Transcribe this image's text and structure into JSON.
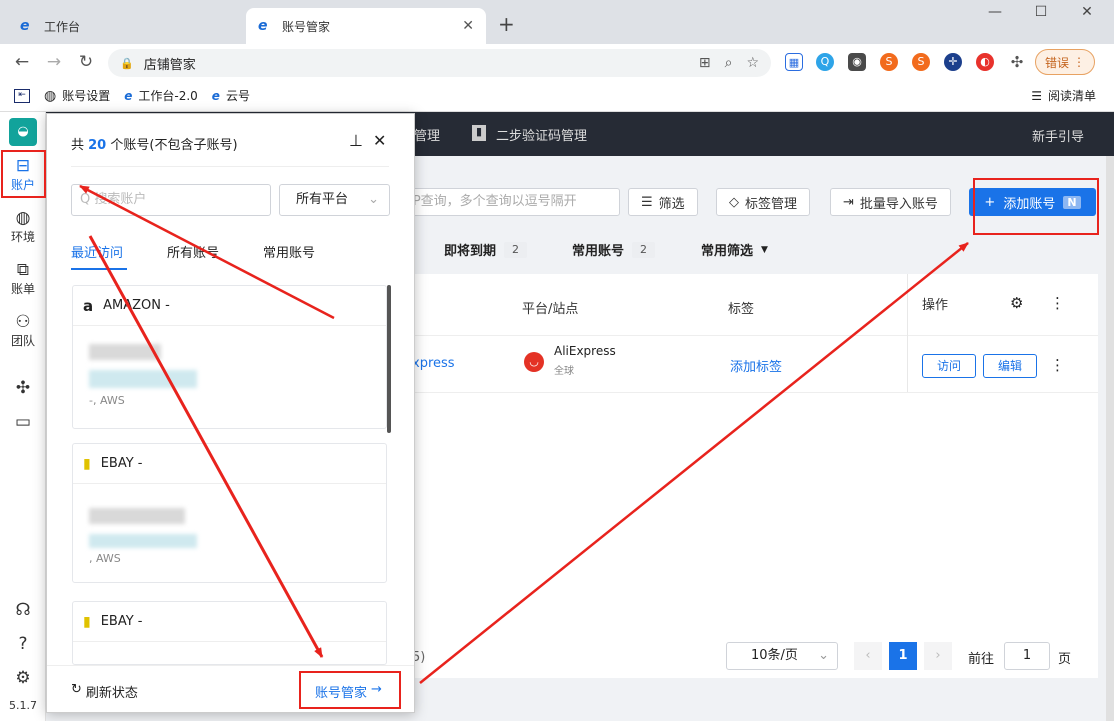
{
  "browser": {
    "tabs": [
      {
        "label": "工作台"
      },
      {
        "label": "账号管家"
      }
    ],
    "new_tab_icon": "plus-icon",
    "address": "店铺管家",
    "error_button": "错误",
    "bookmarks": [
      {
        "label": "账号设置"
      },
      {
        "label": "工作台-2.0"
      },
      {
        "label": "云号"
      }
    ],
    "reading_list": "阅读清单"
  },
  "left_nav": {
    "items": [
      {
        "label": "账户",
        "icon": "store-icon"
      },
      {
        "label": "环境",
        "icon": "globe-icon"
      },
      {
        "label": "账单",
        "icon": "bill-icon"
      },
      {
        "label": "团队",
        "icon": "team-icon"
      }
    ],
    "version": "5.1.7"
  },
  "topbar": {
    "menu_partial": "管理",
    "twofa": "二步验证码管理",
    "guide": "新手引导"
  },
  "toolbar": {
    "search_placeholder": "名、IP查询，多个查询以逗号隔开",
    "filter": "筛选",
    "tags": "标签管理",
    "batch_import": "批量导入账号",
    "add_account": "添加账号",
    "add_badge": "N"
  },
  "filters": [
    {
      "label": "即将到期",
      "count": "2"
    },
    {
      "label": "常用账号",
      "count": "2"
    },
    {
      "label": "常用筛选"
    }
  ],
  "table": {
    "headers": {
      "platform": "平台/站点",
      "tags": "标签",
      "actions": "操作"
    },
    "row": {
      "name_partial": "xpress",
      "platform": "AliExpress",
      "site": "全球",
      "add_tag": "添加标签",
      "visit": "访问",
      "edit": "编辑"
    }
  },
  "pager": {
    "total_partial": "5)",
    "page_size": "10条/页",
    "current": "1",
    "goto_label": "前往",
    "goto_value": "1",
    "page_suffix": "页"
  },
  "popup": {
    "title_prefix": "共 ",
    "count": "20",
    "title_suffix": " 个账号(不包含子账号)",
    "search_placeholder": "Q 搜索账户",
    "platform_select": "所有平台",
    "tabs": [
      "最近访问",
      "所有账号",
      "常用账号"
    ],
    "cards": [
      {
        "platform": "AMAZON -",
        "meta": "-, AWS"
      },
      {
        "platform": "EBAY -",
        "meta": ", AWS"
      },
      {
        "platform": "EBAY -",
        "meta": ""
      }
    ],
    "refresh": "刷新状态",
    "manager_link": "账号管家"
  },
  "colors": {
    "accent": "#1a73e8",
    "annotation": "#e8231d",
    "dark_header": "#262b35"
  }
}
